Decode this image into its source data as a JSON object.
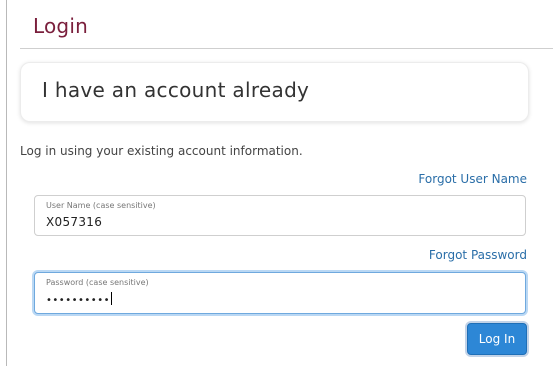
{
  "header": {
    "title": "Login"
  },
  "account_panel": {
    "heading": "I have an account already"
  },
  "instructions": "Log in using your existing account information.",
  "links": {
    "forgot_username": "Forgot User Name",
    "forgot_password": "Forgot Password"
  },
  "username_field": {
    "label": "User Name (case sensitive)",
    "value": "X057316"
  },
  "password_field": {
    "label": "Password (case sensitive)",
    "masked_value": "••••••••••"
  },
  "login_button": {
    "label": "Log In"
  },
  "colors": {
    "title": "#7a1f3c",
    "link": "#2a6ea8",
    "button": "#2d87d6",
    "focus": "#6fa9de"
  }
}
